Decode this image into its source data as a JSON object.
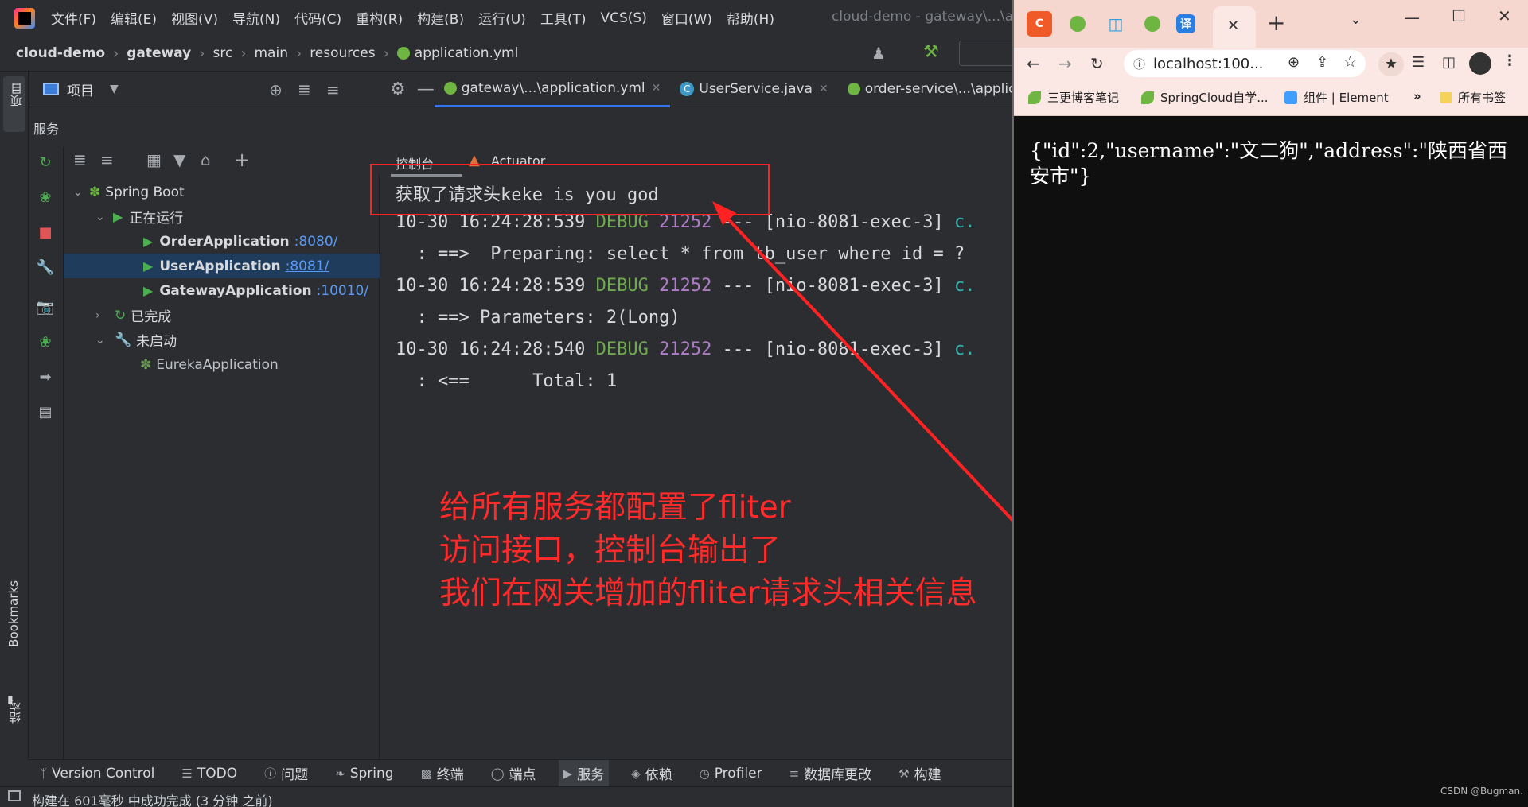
{
  "ide": {
    "menu": [
      "文件(F)",
      "编辑(E)",
      "视图(V)",
      "导航(N)",
      "代码(C)",
      "重构(R)",
      "构建(B)",
      "运行(U)",
      "工具(T)",
      "VCS(S)",
      "窗口(W)",
      "帮助(H)"
    ],
    "window_title": "cloud-demo - gateway\\...\\a",
    "breadcrumb": [
      "cloud-demo",
      "gateway",
      "src",
      "main",
      "resources",
      "application.yml"
    ],
    "left_rail": {
      "project": "项目",
      "bookmarks": "Bookmarks",
      "structure": "结构"
    },
    "project_header": {
      "label": "项目"
    },
    "services_label": "服务",
    "editor_tabs": [
      {
        "label": "gateway\\...\\application.yml"
      },
      {
        "label": "UserService.java"
      },
      {
        "label": "order-service\\...\\applic"
      }
    ],
    "tree": {
      "spring_boot": "Spring Boot",
      "running": "正在运行",
      "apps": [
        {
          "name": "OrderApplication",
          "port": ":8080/"
        },
        {
          "name": "UserApplication",
          "port": ":8081/"
        },
        {
          "name": "GatewayApplication",
          "port": ":10010/"
        }
      ],
      "finished": "已完成",
      "not_started": "未启动",
      "eureka": "EurekaApplication"
    },
    "console_tabs": {
      "console": "控制台",
      "actuator": "Actuator"
    },
    "console_lines": {
      "l1": "获取了请求头keke is you god",
      "l2_ts": "10-30 16:24:28:539 ",
      "l2_level": "DEBUG",
      "l2_pid": " 21252",
      "l2_rest": " --- [nio-8081-exec-3] ",
      "l2_cls": "c.",
      "l3": "  : ==>  Preparing: select * from tb_user where id = ?",
      "l4_ts": "10-30 16:24:28:539 ",
      "l4_level": "DEBUG",
      "l4_pid": " 21252",
      "l4_rest": " --- [nio-8081-exec-3] ",
      "l4_cls": "c.",
      "l5": "  : ==> Parameters: 2(Long)",
      "l6_ts": "10-30 16:24:28:540 ",
      "l6_level": "DEBUG",
      "l6_pid": " 21252",
      "l6_rest": " --- [nio-8081-exec-3] ",
      "l6_cls": "c.",
      "l7": "  : <==      Total: 1"
    },
    "bottom_tools": [
      "Version Control",
      "TODO",
      "问题",
      "Spring",
      "终端",
      "端点",
      "服务",
      "依赖",
      "Profiler",
      "数据库更改",
      "构建"
    ],
    "status": "构建在 601毫秒 中成功完成 (3 分钟 之前)"
  },
  "annotation": {
    "line1": "给所有服务都配置了fliter",
    "line2": "访问接口，控制台输出了",
    "line3": "我们在网关增加的fliter请求头相关信息"
  },
  "browser": {
    "tab_letters": [
      "C",
      "译"
    ],
    "address": "localhost:100...",
    "bookmarks": [
      "三更博客笔记",
      "SpringCloud自学...",
      "组件 | Element",
      "»",
      "所有书签"
    ],
    "response_json": "{\"id\":2,\"username\":\"文二狗\",\"address\":\"陕西省西安市\"}",
    "watermark": "CSDN @Bugman."
  },
  "colors": {
    "annotation_red": "#ff2a2a",
    "selection": "#1f3c5d",
    "accent": "#3574f0"
  }
}
